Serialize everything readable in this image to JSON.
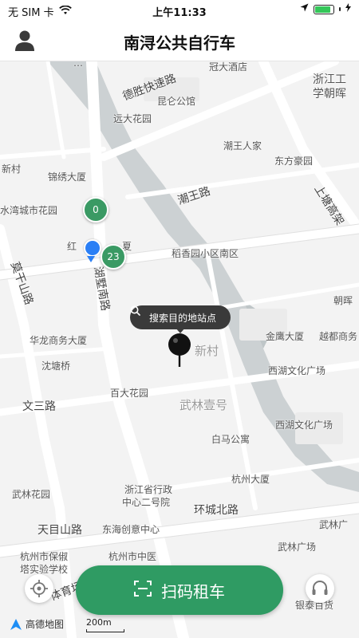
{
  "status_bar": {
    "carrier": "无 SIM 卡",
    "time": "上午11:33",
    "battery_level": 0.9
  },
  "header": {
    "title": "南浔公共自行车",
    "profile_icon": "user-icon"
  },
  "map": {
    "labels": {
      "deshengkuaisulu": "德胜快速路",
      "guandajiudian": "冠大酒店",
      "zhejianggong": "浙江工",
      "xuechaohuiqu": "学朝晖",
      "kunlun": "昆仑公馆",
      "yuanda": "远大花园",
      "chaowangrenjia": "潮王人家",
      "dongfanghaoyuan": "东方豪园",
      "xincun_left": "新村",
      "jinxiu": "锦绣大厦",
      "shuiwan": "水湾城市花园",
      "chaowanglu": "潮王路",
      "shangtanggaojia": "上塘高架",
      "hongxing": "红",
      "xia": "夏",
      "daoxiangyuan": "稻香园小区南区",
      "moganshan": "莫干山路",
      "hushu": "湖墅南路",
      "zhaohui": "朝晖",
      "jinying": "金鹰大厦",
      "yuedu": "越都商务",
      "hualong": "华龙商务大厦",
      "shenqiao": "沈塘桥",
      "xincun_center": "新村",
      "xihu1": "西湖文化广场",
      "wensanlu": "文三路",
      "baida": "百大花园",
      "wulinyihao": "武林壹号",
      "xihu2": "西湖文化广场",
      "baima": "白马公寓",
      "hangzhoudasha": "杭州大厦",
      "wulinhuayuan": "武林花园",
      "xingzheng": "浙江省行政",
      "erhao": "中心二号院",
      "huanchengbeilu": "环城北路",
      "tianmushanlu": "天目山路",
      "donghai": "东海创意中心",
      "wulinguangchang": "武林广场",
      "wulinguang_r": "武林广",
      "baojian1": "杭州市保俶",
      "baojian2": "塔实验学校",
      "zhongyi": "杭州市中医",
      "tiyuchang": "体育场",
      "yintai": "银泰百货"
    },
    "station_markers": [
      {
        "count": "0"
      },
      {
        "count": "23"
      }
    ],
    "search_bubble": "搜索目的地站点",
    "scale_label": "200m",
    "brand_label": "高德地图",
    "colors": {
      "station_green": "#3a9a64",
      "user_blue": "#2a7ff5",
      "water": "#bfc6c8"
    }
  },
  "bottom": {
    "scan_label": "扫码租车",
    "locate_icon": "locate-icon",
    "service_icon": "headset-icon",
    "scan_icon": "scan-icon"
  }
}
